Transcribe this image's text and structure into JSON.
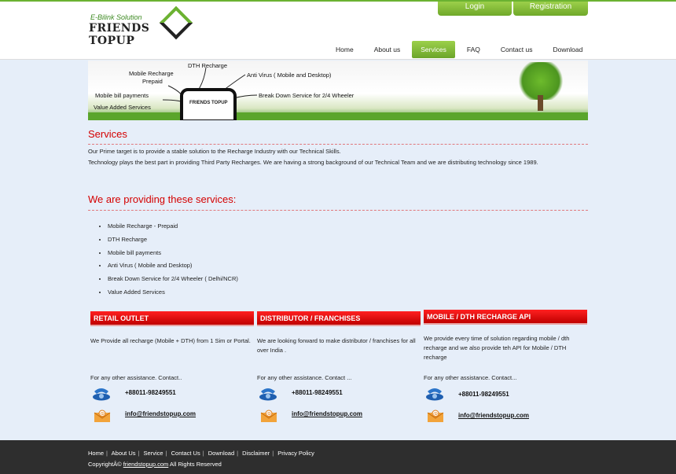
{
  "header": {
    "logo_tagline": "E-Bilink Solution",
    "logo_name": "FRIENDS TOPUP",
    "login_label": "Login",
    "registration_label": "Registration"
  },
  "nav": {
    "items": [
      "Home",
      "About us",
      "Services",
      "FAQ",
      "Contact us",
      "Download"
    ],
    "active": "Services"
  },
  "banner": {
    "labels": {
      "dth": "DTH Recharge",
      "mobile_prepaid": "Mobile Recharge\nPrepaid",
      "mobile_recharge": "Mobile Recharge",
      "prepaid": "Prepaid",
      "antivirus": "Anti Virus ( Mobile and Desktop)",
      "mobile_bill": "Mobile bill payments",
      "breakdown": "Break Down Service for 2/4 Wheeler",
      "vas": "Value Added Services"
    },
    "phone_logo": "FRIENDS TOPUP"
  },
  "services": {
    "title": "Services",
    "para1": "Our Prime target is to provide a stable solution to the Recharge Industry with our Technical Skills.",
    "para2": "Technology plays the best part in providing Third Party Recharges. We are having a strong background of our Technical Team and we are distributing technology since 1989.",
    "providing_title": "We are providing these services:",
    "list": [
      "Mobile Recharge - Prepaid",
      "DTH Recharge",
      "Mobile bill payments",
      "Anti Virus ( Mobile and Desktop)",
      "Break Down Service for 2/4 Wheeler ( Delhi/NCR)",
      "Value Added Services"
    ]
  },
  "boxes": [
    {
      "title": "RETAIL OUTLET",
      "text": "We Provide all recharge (Mobile + DTH) from 1 Sim or Portal.",
      "contact": "For any other assistance. Contact..",
      "phone": "+88011-98249551",
      "email": "info@friendstopup.com"
    },
    {
      "title": "DISTRIBUTOR / FRANCHISES",
      "text": "We are looking forward to make distributor / franchises for all over India .",
      "contact": "For any other assistance. Contact ...",
      "phone": "+88011-98249551",
      "email": "info@friendstopup.com"
    },
    {
      "title": "MOBILE / DTH RECHARGE API",
      "text": "We provide every time of solution regarding mobile / dth recharge and we also provide teh API for Mobile / DTH recharge",
      "contact": "For any other assistance. Contact...",
      "phone": "+88011-98249551",
      "email": "info@friendstopup.com"
    }
  ],
  "footer": {
    "links": [
      "Home",
      "About Us",
      "Service",
      "Contact Us",
      "Download",
      "Disclaimer",
      "Privacy Policy"
    ],
    "copy_prefix": "CopyrightÂ© ",
    "copy_link": "friendstopup.com",
    "copy_suffix": " All Rights Reserved"
  },
  "colors": {
    "accent_green": "#6bb231",
    "heading_red": "#d40000",
    "box_header_red": "#e00000",
    "page_bg": "#e6eef9",
    "footer_bg": "#2e2e2e"
  },
  "icons": {
    "phone": "phone-icon",
    "mail": "mail-icon"
  }
}
